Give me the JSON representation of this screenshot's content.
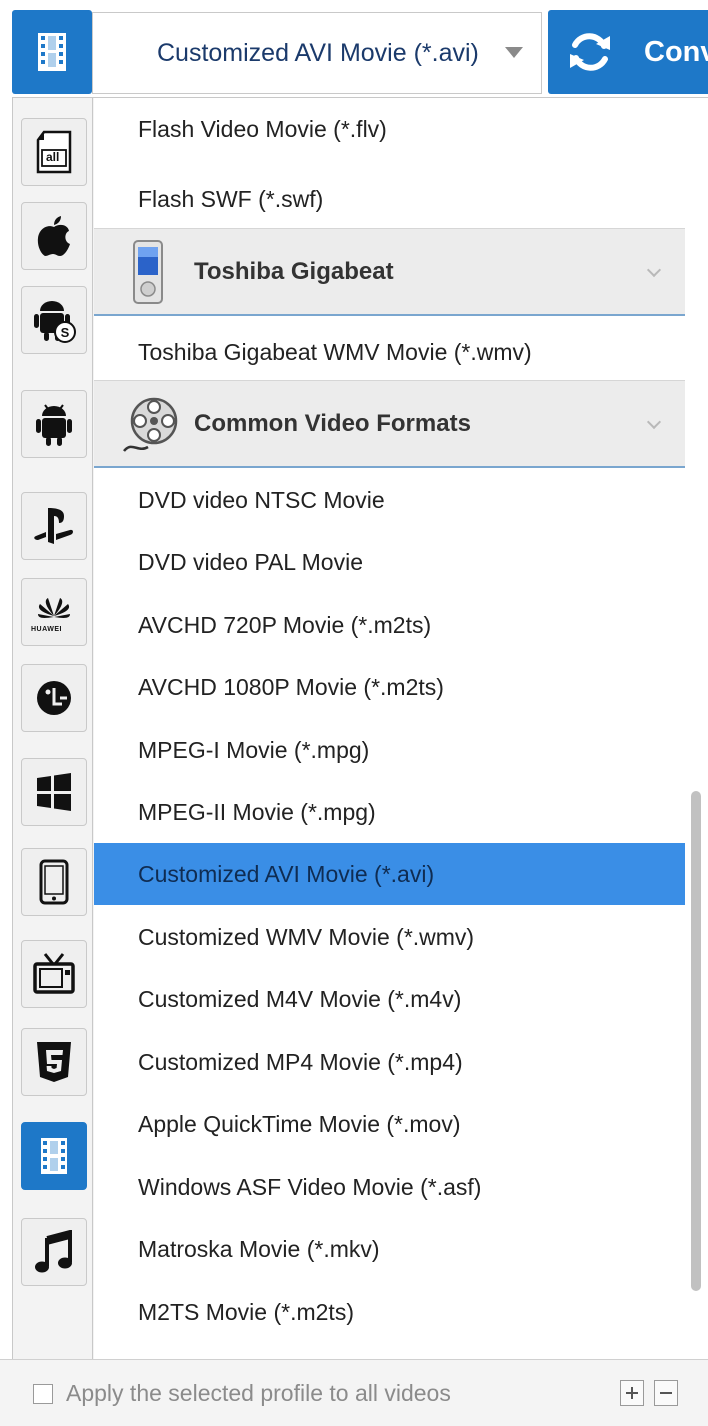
{
  "header": {
    "selected_profile": "Customized AVI Movie (*.avi)",
    "convert_label": "Conv",
    "accent_color": "#1e78c8"
  },
  "sidebar": {
    "categories": [
      {
        "name": "all-formats",
        "label": "all",
        "icon": "all-formats-icon"
      },
      {
        "name": "apple",
        "icon": "apple-icon"
      },
      {
        "name": "android-samsung",
        "icon": "android-samsung-icon"
      },
      {
        "name": "android",
        "icon": "android-icon"
      },
      {
        "name": "playstation",
        "icon": "playstation-icon"
      },
      {
        "name": "huawei",
        "label": "HUAWEI",
        "icon": "huawei-icon"
      },
      {
        "name": "lg",
        "icon": "lg-icon"
      },
      {
        "name": "windows",
        "icon": "windows-icon"
      },
      {
        "name": "phone",
        "icon": "phone-icon"
      },
      {
        "name": "tv",
        "icon": "tv-icon"
      },
      {
        "name": "html5",
        "icon": "html5-icon"
      },
      {
        "name": "video",
        "icon": "film-icon",
        "active": true
      },
      {
        "name": "music",
        "icon": "music-note-icon"
      }
    ]
  },
  "list": {
    "items_top": [
      "Flash Video Movie (*.flv)",
      "Flash SWF (*.swf)"
    ],
    "group_toshiba": {
      "title": "Toshiba Gigabeat",
      "icon": "toshiba-player-icon"
    },
    "items_toshiba": [
      "Toshiba Gigabeat WMV Movie (*.wmv)"
    ],
    "group_common": {
      "title": "Common Video Formats",
      "icon": "film-reel-icon"
    },
    "items_common": [
      "DVD video NTSC Movie",
      "DVD video PAL Movie",
      "AVCHD 720P Movie (*.m2ts)",
      "AVCHD 1080P Movie (*.m2ts)",
      "MPEG-I Movie (*.mpg)",
      "MPEG-II Movie (*.mpg)",
      "Customized AVI Movie (*.avi)",
      "Customized WMV Movie (*.wmv)",
      "Customized M4V Movie (*.m4v)",
      "Customized MP4 Movie (*.mp4)",
      "Apple QuickTime Movie (*.mov)",
      "Windows ASF Video Movie (*.asf)",
      "Matroska Movie (*.mkv)",
      "M2TS Movie (*.m2ts)"
    ],
    "selected_item": "Customized AVI Movie (*.avi)",
    "selected_color": "#3a8ee6"
  },
  "footer": {
    "apply_all_label": "Apply the selected profile to all videos",
    "apply_all_checked": false
  }
}
